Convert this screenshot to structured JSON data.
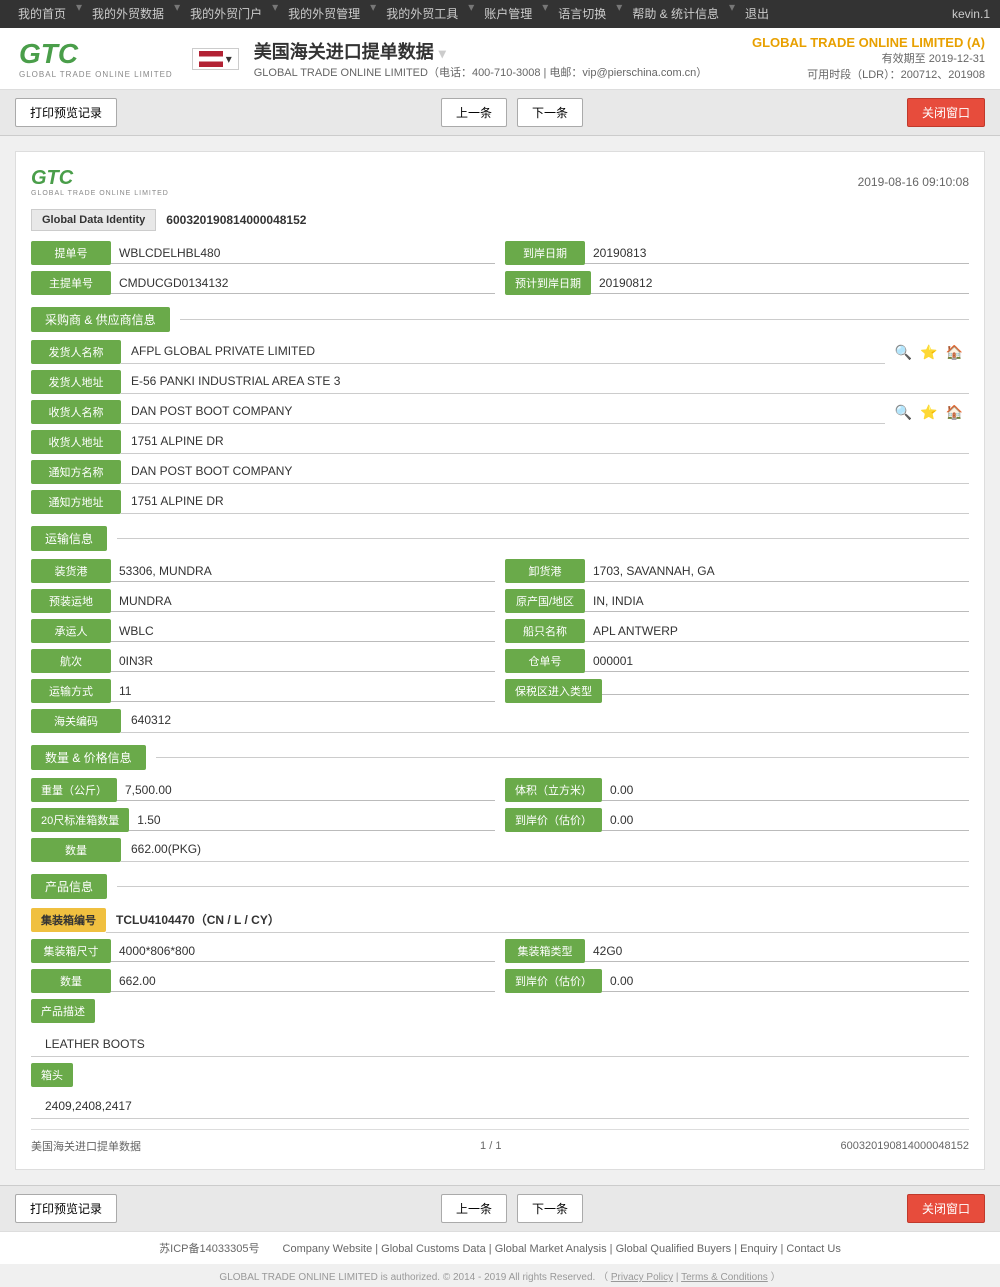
{
  "topnav": {
    "items": [
      "我的首页",
      "我的外贸数据",
      "我的外贸门户",
      "我的外贸管理",
      "我的外贸工具",
      "账户管理",
      "语言切换",
      "帮助 & 统计信息",
      "退出"
    ],
    "user": "kevin.1"
  },
  "header": {
    "title": "美国海关进口提单数据",
    "company_line": "GLOBAL TRADE ONLINE LIMITED（电话：400-710-3008 | 电邮：vip@pierschina.com.cn）",
    "top_company": "GLOBAL TRADE ONLINE LIMITED (A)",
    "valid_to": "有效期至 2019-12-31",
    "ldr": "可用时段（LDR）：200712、201908"
  },
  "toolbar": {
    "print_label": "打印预览记录",
    "prev_label": "上一条",
    "next_label": "下一条",
    "close_label": "关闭窗口"
  },
  "card": {
    "logo_text": "GTC",
    "logo_sub": "GLOBAL TRADE ONLINE LIMITED",
    "date": "2019-08-16 09:10:08",
    "global_data_identity_label": "Global Data Identity",
    "global_data_identity_value": "600320190814000048152",
    "ti_dan_label": "提单号",
    "ti_dan_value": "WBLCDELHBL480",
    "dao_qi_label": "到岸日期",
    "dao_qi_value": "20190813",
    "zhu_ti_dan_label": "主提单号",
    "zhu_ti_dan_value": "CMDUCGD0134132",
    "ji_hua_dao_qi_label": "预计到岸日期",
    "ji_hua_dao_qi_value": "20190812"
  },
  "supplier_section": {
    "title": "采购商 & 供应商信息",
    "fields": [
      {
        "label": "发货人名称",
        "value": "AFPL GLOBAL PRIVATE LIMITED",
        "has_icons": true
      },
      {
        "label": "发货人地址",
        "value": "E-56 PANKI INDUSTRIAL AREA STE 3",
        "has_icons": false
      },
      {
        "label": "收货人名称",
        "value": "DAN POST BOOT COMPANY",
        "has_icons": true
      },
      {
        "label": "收货人地址",
        "value": "1751 ALPINE DR",
        "has_icons": false
      },
      {
        "label": "通知方名称",
        "value": "DAN POST BOOT COMPANY",
        "has_icons": false
      },
      {
        "label": "通知方地址",
        "value": "1751 ALPINE DR",
        "has_icons": false
      }
    ]
  },
  "transport_section": {
    "title": "运输信息",
    "left_fields": [
      {
        "label": "装货港",
        "value": "53306, MUNDRA"
      },
      {
        "label": "预装运地",
        "value": "MUNDRA"
      },
      {
        "label": "承运人",
        "value": "WBLC"
      },
      {
        "label": "航次",
        "value": "0IN3R"
      },
      {
        "label": "运输方式",
        "value": "11"
      },
      {
        "label": "海关编码",
        "value": "640312"
      }
    ],
    "right_fields": [
      {
        "label": "卸货港",
        "value": "1703, SAVANNAH, GA"
      },
      {
        "label": "原产国/地区",
        "value": "IN, INDIA"
      },
      {
        "label": "船只名称",
        "value": "APL ANTWERP"
      },
      {
        "label": "仓单号",
        "value": "000001"
      },
      {
        "label": "保税区进入类型",
        "value": ""
      }
    ]
  },
  "quantity_section": {
    "title": "数量 & 价格信息",
    "fields": [
      {
        "label": "重量（公斤）",
        "value": "7,500.00",
        "right_label": "体积（立方米）",
        "right_value": "0.00"
      },
      {
        "label": "20尺标准箱数量",
        "value": "1.50",
        "right_label": "到岸价（估价）",
        "right_value": "0.00"
      },
      {
        "label": "数量",
        "value": "662.00(PKG)",
        "right_label": "",
        "right_value": ""
      }
    ]
  },
  "product_section": {
    "title": "产品信息",
    "container_no_label": "集装箱编号",
    "container_no_value": "TCLU4104470（CN / L / CY）",
    "container_size_label": "集装箱尺寸",
    "container_size_value": "4000*806*800",
    "container_type_label": "集装箱类型",
    "container_type_value": "42G0",
    "quantity_label": "数量",
    "quantity_value": "662.00",
    "landed_price_label": "到岸价（估价）",
    "landed_price_value": "0.00",
    "product_desc_label": "产品描述",
    "product_desc_value": "LEATHER BOOTS",
    "marks_label": "箱头",
    "marks_value": "2409,2408,2417"
  },
  "card_footer": {
    "source": "美国海关进口提单数据",
    "page": "1 / 1",
    "id": "600320190814000048152"
  },
  "footer": {
    "links": [
      "Company Website",
      "Global Customs Data",
      "Global Market Analysis",
      "Global Qualified Buyers",
      "Enquiry",
      "Contact Us"
    ],
    "copyright": "GLOBAL TRADE ONLINE LIMITED is authorized. © 2014 - 2019 All rights Reserved.",
    "privacy": "Privacy Policy",
    "terms": "Terms & Conditions",
    "icp": "苏ICP备14033305号"
  }
}
